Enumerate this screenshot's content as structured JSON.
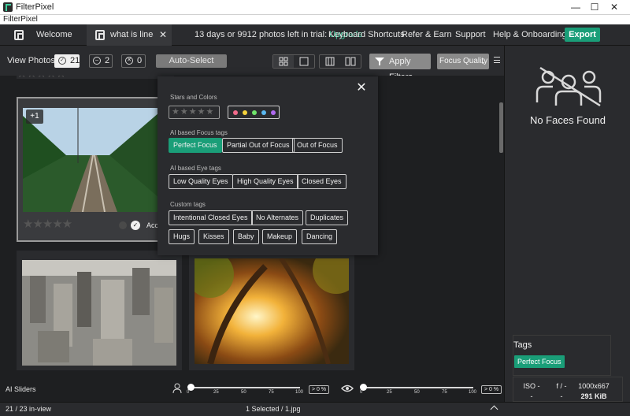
{
  "window": {
    "title": "FilterPixel",
    "minimize": "—",
    "maximize": "☐",
    "close": "✕"
  },
  "menubar": {
    "label": "FilterPixel"
  },
  "tabs": [
    {
      "label": "Welcome"
    },
    {
      "label": "what is linear p"
    }
  ],
  "topnav": {
    "trial": "13 days or 9912 photos left in trial:",
    "upgrade": "Upgrade",
    "shortcuts": "Keyboard Shortcuts",
    "refer": "Refer & Earn",
    "support": "Support",
    "help": "Help & Onboarding",
    "export": "Export"
  },
  "toolbar": {
    "view_photos": "View Photos:",
    "counts": [
      {
        "value": "21",
        "icon": "check-circle-icon"
      },
      {
        "value": "2",
        "icon": "minus-circle-icon"
      },
      {
        "value": "0",
        "icon": "x-circle-icon"
      }
    ],
    "auto_select": "Auto-Select",
    "apply_filters": "Apply Filters",
    "focus_quality": "Focus Quality"
  },
  "grid": {
    "badge": "+1",
    "accept_label": "Acc",
    "stars_total": 5
  },
  "popup": {
    "stars_colors_title": "Stars and Colors",
    "stars_placeholder": "★★★★★",
    "colors": [
      "#f06a8a",
      "#f5d33c",
      "#6ee36a",
      "#5ab8f0",
      "#b06af0"
    ],
    "focus_title": "AI based Focus tags",
    "focus_tags": [
      {
        "label": "Perfect Focus",
        "active": true
      },
      {
        "label": "Partial Out of Focus",
        "active": false
      },
      {
        "label": "Out of Focus",
        "active": false
      }
    ],
    "eye_title": "AI based Eye tags",
    "eye_tags": [
      "Low Quality Eyes",
      "High Quality Eyes",
      "Closed Eyes"
    ],
    "custom_title": "Custom tags",
    "custom_tags_row1": [
      "Intentional Closed Eyes",
      "No Alternates",
      "Duplicates"
    ],
    "custom_tags_row2": [
      "Hugs",
      "Kisses",
      "Baby",
      "Makeup",
      "Dancing"
    ]
  },
  "rightpanel": {
    "no_faces": "No Faces Found",
    "tags_title": "Tags",
    "tag": "Perfect Focus",
    "iso_label": "ISO -",
    "iso_value": "-",
    "f_label": "f / -",
    "f_value": "-",
    "dimensions": "1000x667",
    "filesize": "291 KiB"
  },
  "sliders": {
    "title": "AI Sliders",
    "ticks": [
      "0",
      "25",
      "50",
      "75",
      "100"
    ],
    "face_pct": "> 0 %",
    "eye_pct": "> 0 %"
  },
  "status": {
    "in_view": "21 / 23 in-view",
    "selected": "1 Selected / 1.jpg"
  }
}
